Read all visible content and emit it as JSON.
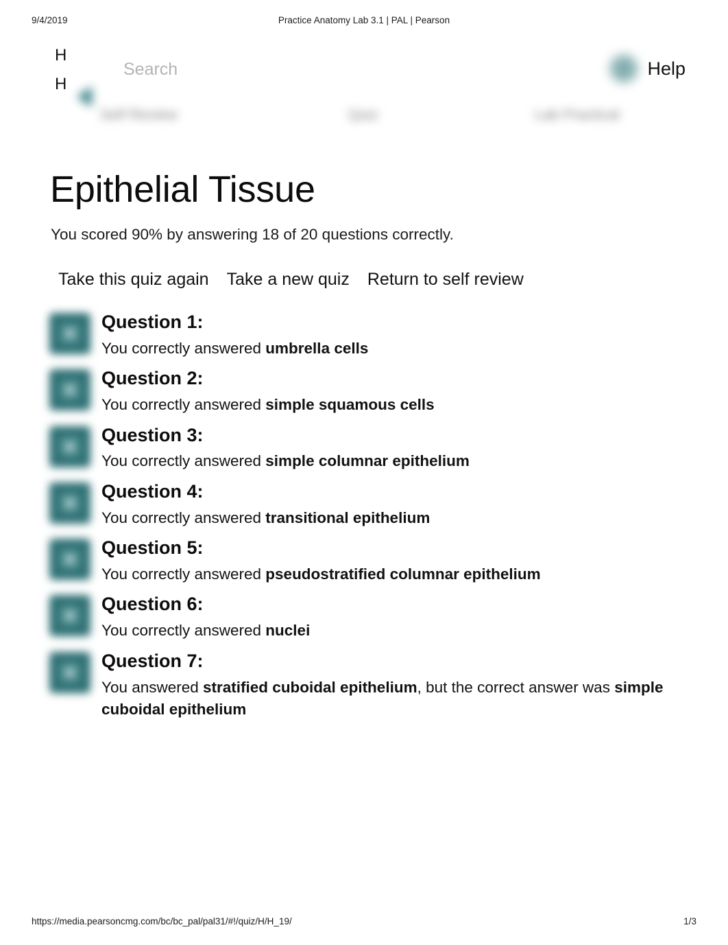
{
  "print": {
    "date": "9/4/2019",
    "doc_title": "Practice Anatomy Lab 3.1 | PAL | Pearson",
    "url": "https://media.pearsoncmg.com/bc/bc_pal/pal31/#!/quiz/H/H_19/",
    "page_number": "1/3"
  },
  "topbar": {
    "brand_line1": "H",
    "brand_line2": "H",
    "back_icon": "back-arrow-icon",
    "search_placeholder": "Search",
    "search_value": "",
    "help_icon": "help-circle-icon",
    "help_label": "Help"
  },
  "tabs": [
    {
      "label": "Self Review"
    },
    {
      "label": "Quiz"
    },
    {
      "label": "Lab Practical"
    }
  ],
  "main": {
    "title": "Epithelial Tissue",
    "score_text": "You scored 90% by answering 18 of 20 questions correctly.",
    "score_percent": "90%",
    "correct_count": "18",
    "total_count": "20",
    "actions": [
      {
        "label": "Take this quiz again"
      },
      {
        "label": "Take a new quiz"
      },
      {
        "label": "Return to self review"
      }
    ],
    "questions": [
      {
        "heading": "Question 1:",
        "thumb_icon": "quiz-thumbnail-icon",
        "prefix": "You correctly answered ",
        "answer": "umbrella cells",
        "middle": "",
        "correct_answer": ""
      },
      {
        "heading": "Question 2:",
        "thumb_icon": "quiz-thumbnail-icon",
        "prefix": "You correctly answered ",
        "answer": "simple squamous cells",
        "middle": "",
        "correct_answer": ""
      },
      {
        "heading": "Question 3:",
        "thumb_icon": "quiz-thumbnail-icon",
        "prefix": "You correctly answered ",
        "answer": "simple columnar epithelium",
        "middle": "",
        "correct_answer": ""
      },
      {
        "heading": "Question 4:",
        "thumb_icon": "quiz-thumbnail-icon",
        "prefix": "You correctly answered ",
        "answer": "transitional epithelium",
        "middle": "",
        "correct_answer": ""
      },
      {
        "heading": "Question 5:",
        "thumb_icon": "quiz-thumbnail-icon",
        "prefix": "You correctly answered ",
        "answer": "pseudostratified columnar epithelium",
        "middle": "",
        "correct_answer": ""
      },
      {
        "heading": "Question 6:",
        "thumb_icon": "quiz-thumbnail-icon",
        "prefix": "You correctly answered ",
        "answer": "nuclei",
        "middle": "",
        "correct_answer": ""
      },
      {
        "heading": "Question 7:",
        "thumb_icon": "quiz-thumbnail-icon",
        "prefix": "You answered ",
        "answer": "stratified cuboidal epithelium",
        "middle": ", but the correct answer was ",
        "correct_answer": "simple cuboidal epithelium"
      }
    ]
  },
  "colors": {
    "teal": "#2d6f73",
    "teal_light": "#4f8d90",
    "text": "#111111",
    "muted": "#7d7d7d"
  }
}
